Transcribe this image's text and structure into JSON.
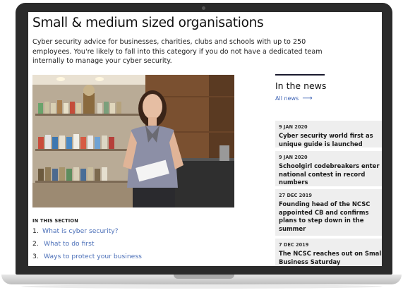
{
  "page": {
    "title": "Small & medium sized organisations",
    "intro": "Cyber security advice for businesses, charities, clubs and schools with up to 250 employees. You're likely to fall into this category if you do not have a dedicated team internally to manage your cyber security."
  },
  "section": {
    "label": "IN THIS SECTION",
    "items": [
      {
        "num": "1.",
        "label": "What is cyber security?"
      },
      {
        "num": "2.",
        "label": "What to do first"
      },
      {
        "num": "3.",
        "label": "Ways to protect your business"
      }
    ]
  },
  "news": {
    "title": "In the news",
    "all_label": "All news",
    "items": [
      {
        "date": "9 JAN 2020",
        "headline": "Cyber security world first as unique guide is launched"
      },
      {
        "date": "9 JAN 2020",
        "headline": "Schoolgirl codebreakers enter national contest in record numbers"
      },
      {
        "date": "27 DEC 2019",
        "headline": "Founding head of the NCSC appointed CB and confirms plans to step down in the summer"
      },
      {
        "date": "7 DEC 2019",
        "headline": "The NCSC reaches out on Small Business Saturday"
      }
    ]
  },
  "colors": {
    "link": "#4b6fb8",
    "card_bg": "#eeeeee",
    "frame": "#2b2b2b"
  },
  "icons": {
    "all_news_arrow": "arrow-right-icon",
    "hero": "shop-owner-photo"
  }
}
